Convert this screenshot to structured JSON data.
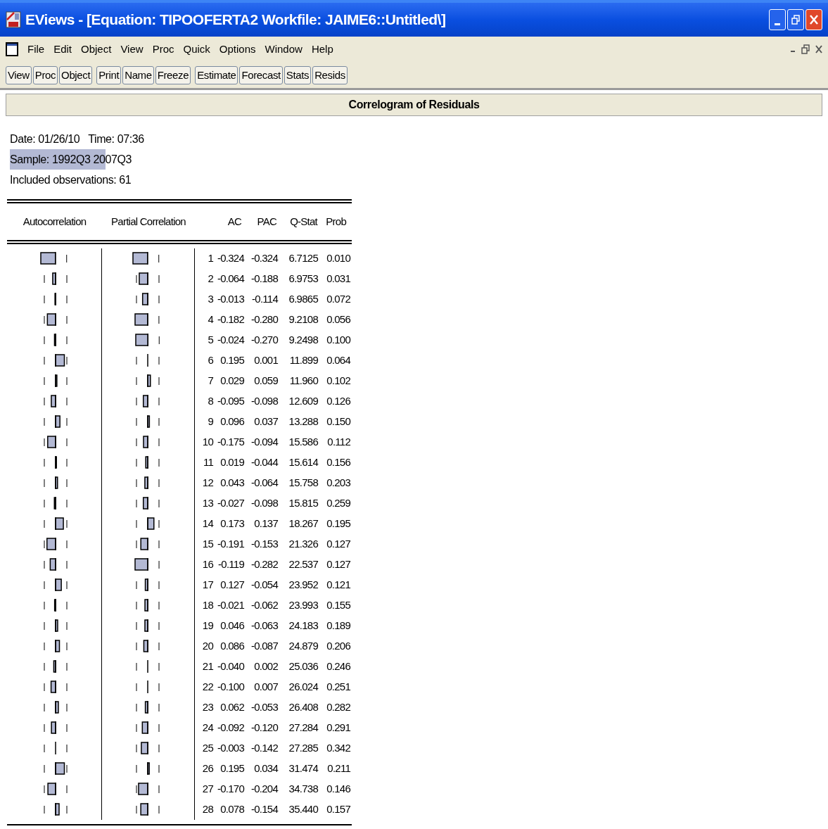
{
  "window": {
    "title": "EViews - [Equation: TIPOOFERTA2   Workfile: JAIME6::Untitled\\]"
  },
  "menu": [
    "File",
    "Edit",
    "Object",
    "View",
    "Proc",
    "Quick",
    "Options",
    "Window",
    "Help"
  ],
  "toolbar": [
    [
      "View",
      "Proc",
      "Object"
    ],
    [
      "Print",
      "Name",
      "Freeze"
    ],
    [
      "Estimate",
      "Forecast",
      "Stats",
      "Resids"
    ]
  ],
  "view_title": "Correlogram of Residuals",
  "info": {
    "date": "Date: 01/26/10   Time: 07:36",
    "sample_selected": "Sample: 1992Q3 20",
    "sample_rest": "07Q3",
    "observations": "Included observations: 61"
  },
  "columns": [
    "Autocorrelation",
    "Partial Correlation",
    "AC",
    "PAC",
    "Q-Stat",
    "Prob"
  ],
  "rows": [
    [
      "1",
      "-0.324",
      "-0.324",
      "6.7125",
      "0.010"
    ],
    [
      "2",
      "-0.064",
      "-0.188",
      "6.9753",
      "0.031"
    ],
    [
      "3",
      "-0.013",
      "-0.114",
      "6.9865",
      "0.072"
    ],
    [
      "4",
      "-0.182",
      "-0.280",
      "9.2108",
      "0.056"
    ],
    [
      "5",
      "-0.024",
      "-0.270",
      "9.2498",
      "0.100"
    ],
    [
      "6",
      "0.195",
      "0.001",
      "11.899",
      "0.064"
    ],
    [
      "7",
      "0.029",
      "0.059",
      "11.960",
      "0.102"
    ],
    [
      "8",
      "-0.095",
      "-0.098",
      "12.609",
      "0.126"
    ],
    [
      "9",
      "0.096",
      "0.037",
      "13.288",
      "0.150"
    ],
    [
      "10",
      "-0.175",
      "-0.094",
      "15.586",
      "0.112"
    ],
    [
      "11",
      "0.019",
      "-0.044",
      "15.614",
      "0.156"
    ],
    [
      "12",
      "0.043",
      "-0.064",
      "15.758",
      "0.203"
    ],
    [
      "13",
      "-0.027",
      "-0.098",
      "15.815",
      "0.259"
    ],
    [
      "14",
      "0.173",
      "0.137",
      "18.267",
      "0.195"
    ],
    [
      "15",
      "-0.191",
      "-0.153",
      "21.326",
      "0.127"
    ],
    [
      "16",
      "-0.119",
      "-0.282",
      "22.537",
      "0.127"
    ],
    [
      "17",
      "0.127",
      "-0.054",
      "23.952",
      "0.121"
    ],
    [
      "18",
      "-0.021",
      "-0.062",
      "23.993",
      "0.155"
    ],
    [
      "19",
      "0.046",
      "-0.063",
      "24.183",
      "0.189"
    ],
    [
      "20",
      "0.086",
      "-0.087",
      "24.879",
      "0.206"
    ],
    [
      "21",
      "-0.040",
      "0.002",
      "25.036",
      "0.246"
    ],
    [
      "22",
      "-0.100",
      "0.007",
      "26.024",
      "0.251"
    ],
    [
      "23",
      "0.062",
      "-0.053",
      "26.408",
      "0.282"
    ],
    [
      "24",
      "-0.092",
      "-0.120",
      "27.284",
      "0.291"
    ],
    [
      "25",
      "-0.003",
      "-0.142",
      "27.285",
      "0.342"
    ],
    [
      "26",
      "0.195",
      "0.034",
      "31.474",
      "0.211"
    ],
    [
      "27",
      "-0.170",
      "-0.204",
      "34.738",
      "0.146"
    ],
    [
      "28",
      "0.078",
      "-0.154",
      "35.440",
      "0.157"
    ]
  ]
}
